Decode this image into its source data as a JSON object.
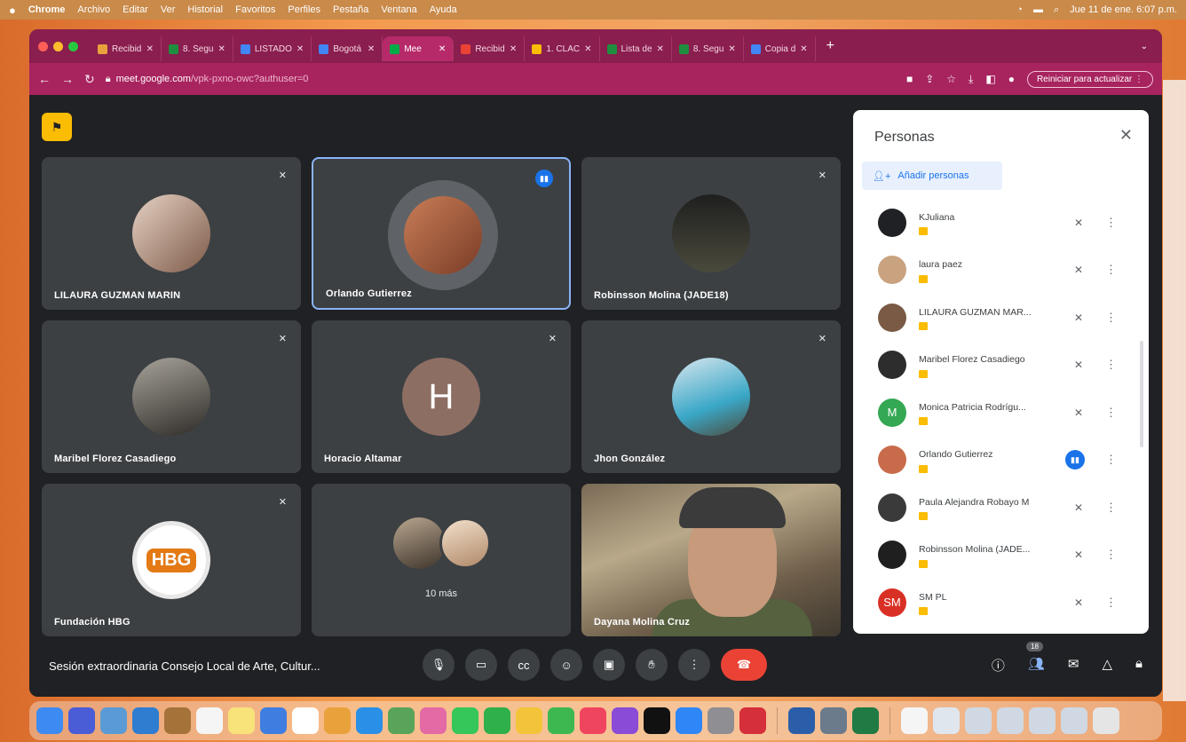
{
  "menubar": {
    "app": "Chrome",
    "items": [
      "Archivo",
      "Editar",
      "Ver",
      "Historial",
      "Favoritos",
      "Perfiles",
      "Pestaña",
      "Ventana",
      "Ayuda"
    ],
    "datetime": "Jue 11 de ene.  6:07 p.m."
  },
  "tabs": [
    {
      "label": "Recibid",
      "color": "#e8a23c"
    },
    {
      "label": "8. Segu",
      "color": "#1e8e3e"
    },
    {
      "label": "LISTADO",
      "color": "#4285f4"
    },
    {
      "label": "Bogotá",
      "color": "#4285f4"
    },
    {
      "label": "Mee",
      "color": "#00ac47",
      "active": true
    },
    {
      "label": "Recibid",
      "color": "#ea4335"
    },
    {
      "label": "1. CLAC",
      "color": "#fbbc04"
    },
    {
      "label": "Lista de",
      "color": "#1e8e3e"
    },
    {
      "label": "8. Segu",
      "color": "#1e8e3e"
    },
    {
      "label": "Copia d",
      "color": "#4285f4"
    }
  ],
  "address": {
    "domain": "meet.google.com",
    "path": "/vpk-pxno-owc?authuser=0",
    "reload_label": "Reiniciar para actualizar"
  },
  "tiles": [
    {
      "name": "LILAURA GUZMAN MARIN"
    },
    {
      "name": "Orlando Gutierrez"
    },
    {
      "name": "Robinsson Molina (JADE18)"
    },
    {
      "name": "Maribel Florez Casadiego"
    },
    {
      "name": "Horacio Altamar",
      "initial": "H"
    },
    {
      "name": "Jhon González"
    },
    {
      "name": "Fundación HBG",
      "logo_text": "HBG"
    },
    {
      "name": "",
      "more_label": "10 más"
    },
    {
      "name": "Dayana Molina Cruz"
    }
  ],
  "panel": {
    "title": "Personas",
    "add_label": "Añadir personas",
    "people": [
      {
        "name": "KJuliana",
        "color": "#202124",
        "initials": ""
      },
      {
        "name": "laura paez",
        "color": "#c9a27f",
        "initials": ""
      },
      {
        "name": "LILAURA GUZMAN MAR...",
        "color": "#7a5a44",
        "initials": ""
      },
      {
        "name": "Maribel Florez Casadiego",
        "color": "#2d2d2d",
        "initials": ""
      },
      {
        "name": "Monica Patricia Rodrígu...",
        "color": "#34a853",
        "initials": "M"
      },
      {
        "name": "Orlando Gutierrez",
        "color": "#c86b4a",
        "initials": "",
        "speaking": true
      },
      {
        "name": "Paula Alejandra Robayo M",
        "color": "#3a3a3a",
        "initials": ""
      },
      {
        "name": "Robinsson Molina (JADE...",
        "color": "#1f1f1f",
        "initials": ""
      },
      {
        "name": "SM PL",
        "color": "#d93025",
        "initials": "SM"
      }
    ]
  },
  "bottom": {
    "meeting_title": "Sesión extraordinaria Consejo Local de Arte, Cultur...",
    "participant_count": "18"
  }
}
